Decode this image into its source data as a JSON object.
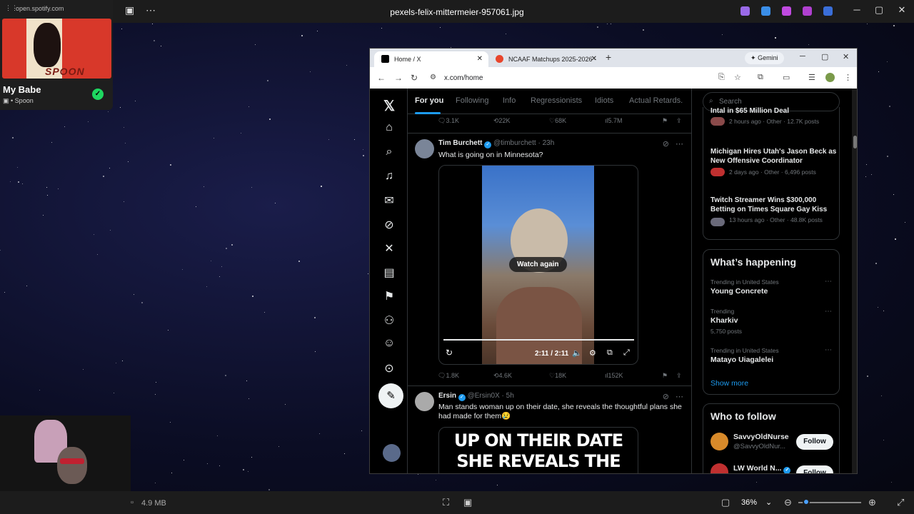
{
  "viewer": {
    "file_name": "pexels-felix-mittermeier-957061.jpg",
    "file_size": "4.9 MB",
    "zoom": "36%"
  },
  "spotify": {
    "url": "open.spotify.com",
    "track": "My Babe",
    "artist": "• Spoon",
    "album_art_text": "SPOON"
  },
  "browser": {
    "tabs": [
      {
        "label": "Home / X",
        "favicon": "x-icon"
      },
      {
        "label": "NCAAF Matchups 2025-2026 -",
        "favicon": "ncaaf-icon"
      }
    ],
    "gemini_label": "Gemini",
    "url": "x.com/home"
  },
  "feed": {
    "tabs": [
      "For you",
      "Following",
      "Info",
      "Regressionists",
      "Idiots",
      "Actual Retards."
    ],
    "top_actions": {
      "replies": "3.1K",
      "reposts": "22K",
      "likes": "68K",
      "views": "5.7M"
    },
    "tweets": [
      {
        "name": "Tim Burchett",
        "handle": "@timburchett",
        "time": "· 23h",
        "text": "What is going on in Minnesota?",
        "video": {
          "overlay": "Watch again",
          "time": "2:11 / 2:11",
          "progress": 1.0
        },
        "actions": {
          "replies": "1.8K",
          "reposts": "4.6K",
          "likes": "18K",
          "views": "152K"
        }
      },
      {
        "name": "Ersin",
        "handle": "@Ersin0X",
        "time": "· 5h",
        "text": "Man stands woman up on their date, she reveals the thoughtful plans she had made for them😢",
        "image_text": "UP ON THEIR DATE SHE REVEALS THE THOUGHTFUL PLANS SHE HAD FOR THEM"
      }
    ]
  },
  "sidebar": {
    "search_placeholder": "Search",
    "news": [
      {
        "title": "Intal in $65 Million Deal",
        "meta": "2 hours ago · Other · 12.7K posts"
      },
      {
        "title": "Michigan Hires Utah's Jason Beck as New Offensive Coordinator",
        "meta": "2 days ago · Other · 6,496 posts"
      },
      {
        "title": "Twitch Streamer Wins $300,000 Betting on Times Square Gay Kiss",
        "meta": "13 hours ago · Other · 48.8K posts"
      }
    ],
    "whats_happening": {
      "title": "What’s happening",
      "trends": [
        {
          "context": "Trending in United States",
          "name": "Young Concrete",
          "posts": ""
        },
        {
          "context": "Trending",
          "name": "Kharkiv",
          "posts": "5,750 posts"
        },
        {
          "context": "Trending in United States",
          "name": "Matayo Uiagalelei",
          "posts": ""
        }
      ],
      "show_more": "Show more"
    },
    "who_to_follow": {
      "title": "Who to follow",
      "accounts": [
        {
          "name": "SavvyOldNurse",
          "handle": "@SavvyOldNur...",
          "button": "Follow"
        },
        {
          "name": "LW World N...",
          "handle": "",
          "button": "Follow"
        }
      ]
    }
  },
  "colors": {
    "accent": "#1d9bf0",
    "spotify_green": "#1ed760",
    "x_background": "#000000"
  }
}
